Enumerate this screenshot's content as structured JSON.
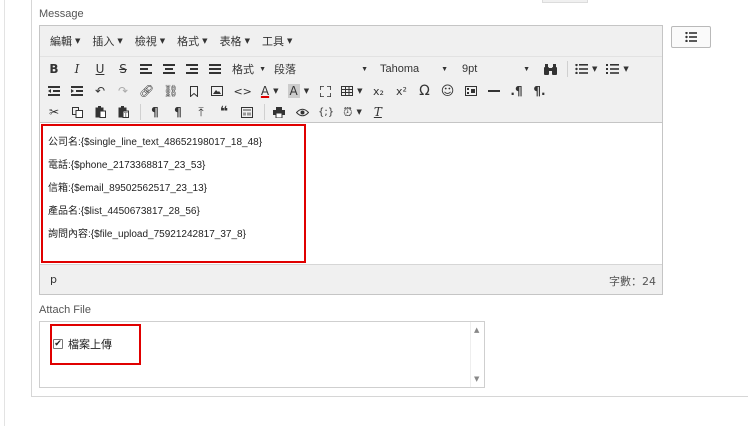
{
  "message_label": "Message",
  "attach_label": "Attach File",
  "menubar": [
    {
      "label": "編輯"
    },
    {
      "label": "插入"
    },
    {
      "label": "檢視"
    },
    {
      "label": "格式"
    },
    {
      "label": "表格"
    },
    {
      "label": "工具"
    }
  ],
  "toolbar": {
    "format_select": "格式",
    "block_select": "段落",
    "font_select": "Tahoma",
    "size_select": "9pt"
  },
  "content_lines": [
    "公司名:{$single_line_text_48652198017_18_48}",
    "電話:{$phone_2173368817_23_53}",
    "信箱:{$email_89502562517_23_13}",
    "產品名:{$list_4450673817_28_56}",
    "詢問內容:{$file_upload_75921242817_37_8}"
  ],
  "status": {
    "path": "p",
    "word_count": "字數：24"
  },
  "attach": {
    "item_label": "檔案上傳",
    "checked": true
  },
  "colors": {
    "highlight": "#e00000",
    "toolbar_bg": "#f0f0f0"
  }
}
